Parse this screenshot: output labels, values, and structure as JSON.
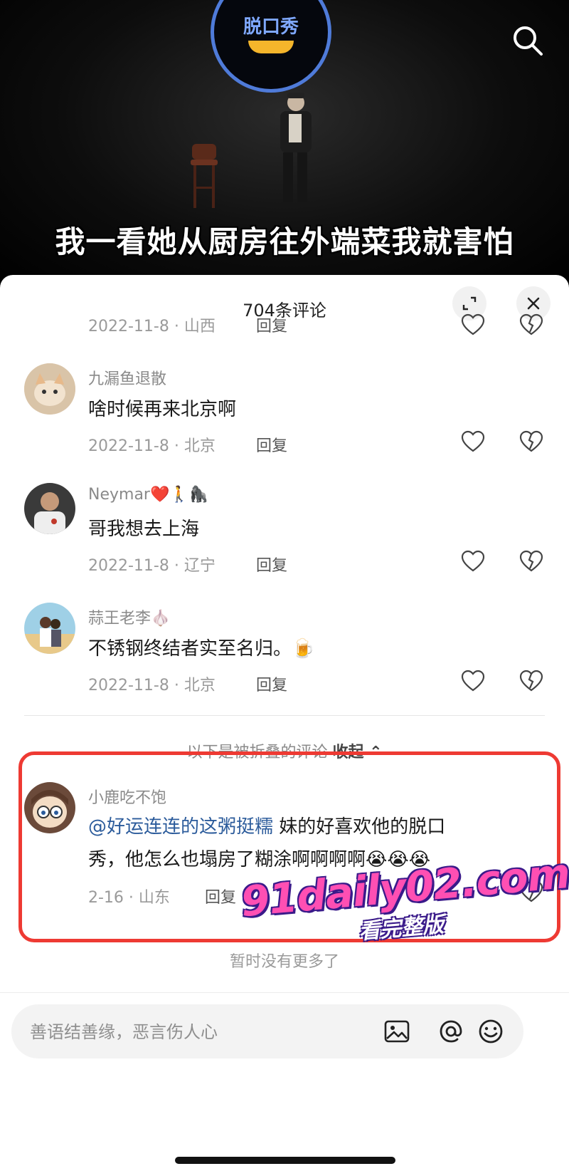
{
  "video": {
    "logo_text": "脱口秀",
    "subtitle": "我一看她从厨房往外端菜我就害怕"
  },
  "sheet": {
    "title": "704条评论"
  },
  "comments": [
    {
      "name": "",
      "text": "",
      "date": "2022-11-8 · 山西",
      "reply": "回复"
    },
    {
      "name": "九漏鱼退散",
      "text": "啥时候再来北京啊",
      "date": "2022-11-8 · 北京",
      "reply": "回复"
    },
    {
      "name": "Neymar❤️🚶🦍",
      "text": "哥我想去上海",
      "date": "2022-11-8 · 辽宁",
      "reply": "回复"
    },
    {
      "name": "蒜王老李🧄",
      "text": "不锈钢终结者实至名归。🍺",
      "date": "2022-11-8 · 北京",
      "reply": "回复"
    }
  ],
  "folded": {
    "text": "以下是被折叠的评论",
    "collapse": "收起 ⌃"
  },
  "folded_comment": {
    "name": "小鹿吃不饱",
    "mention": "@好运连连的这粥挺糯",
    "text_line1": " 妹的好喜欢他的脱口",
    "text_line2": "秀，他怎么也塌房了糊涂啊啊啊啊😭😭😭",
    "date": "2-16 · 山东",
    "reply": "回复"
  },
  "watermark": {
    "main": "91daily02.com",
    "sub": "看完整版"
  },
  "no_more": "暂时没有更多了",
  "input": {
    "placeholder": "善语结善缘，恶言伤人心"
  }
}
